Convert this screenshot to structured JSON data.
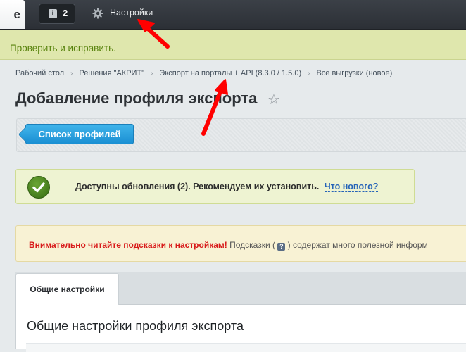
{
  "topbar": {
    "edge_tab_letter": "е",
    "notifications_count": "2",
    "settings_label": "Настройки"
  },
  "notice": {
    "text": "Проверить и исправить."
  },
  "breadcrumbs": [
    "Рабочий стол",
    "Решения \"АКРИТ\"",
    "Экспорт на порталы + API (8.3.0 / 1.5.0)",
    "Все выгрузки (новое)"
  ],
  "page": {
    "title": "Добавление профиля экспорта"
  },
  "toolbar": {
    "profiles_list_button": "Список профилей"
  },
  "update_notice": {
    "message": "Доступны обновления (2). Рекомендуем их установить.",
    "link": "Что нового?"
  },
  "hint_notice": {
    "warning": "Внимательно читайте подсказки к настройкам!",
    "text_before_icon": "Подсказки (",
    "icon_glyph": "?",
    "text_after_icon": ") содержат много полезной информ"
  },
  "tabs": [
    {
      "label": "Общие настройки",
      "active": true
    }
  ],
  "section": {
    "heading": "Общие настройки профиля экспорта"
  },
  "colors": {
    "primary_button": "#1a8fd3",
    "notice_green_text": "#58830d",
    "warning_red": "#d81a1a",
    "link_blue": "#2563b8",
    "annotation_red": "#ff0000"
  },
  "icons": [
    "info-icon",
    "gear-icon",
    "star-icon",
    "check-icon",
    "help-icon"
  ]
}
